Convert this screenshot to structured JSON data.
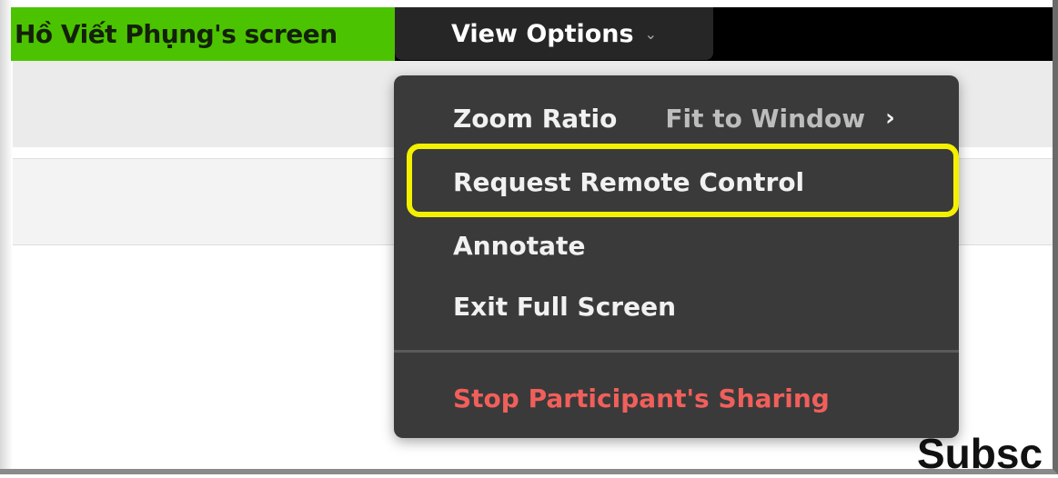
{
  "header": {
    "screen_owner": "Hồ Viết Phụng's screen",
    "view_options_label": "View Options",
    "view_options_chevron": "⌄"
  },
  "menu": {
    "zoom_ratio_label": "Zoom Ratio",
    "zoom_ratio_value": "Fit to Window",
    "zoom_ratio_arrow": "›",
    "items": [
      {
        "label": "Request Remote Control"
      },
      {
        "label": "Annotate"
      },
      {
        "label": "Exit Full Screen"
      },
      {
        "label": "Stop Participant's Sharing"
      }
    ]
  },
  "background": {
    "text_fragment": "Subsc"
  },
  "colors": {
    "green_bar": "#4cc300",
    "menu_bg": "#3a3a3a",
    "highlight": "#f3f000",
    "danger_text": "#f15f5b"
  }
}
